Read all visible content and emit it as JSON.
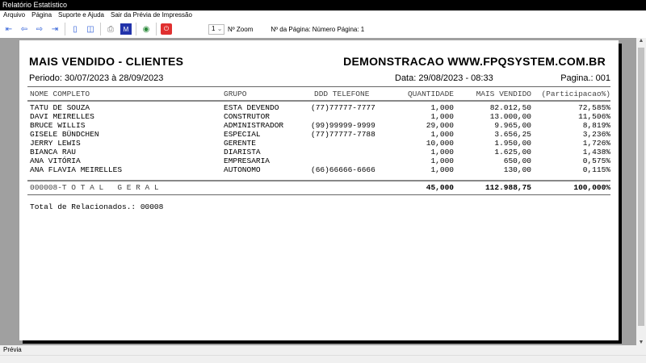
{
  "window": {
    "title": "Relatório Estatístico"
  },
  "menu": [
    "Arquivo",
    "Página",
    "Suporte e Ajuda",
    "Sair da Prévia de Impressão"
  ],
  "toolbar": {
    "page_select": "1",
    "zoom_label": "Nº Zoom",
    "page_info": "Nº da Página: Número Página: 1"
  },
  "report": {
    "title": "MAIS VENDIDO - CLIENTES",
    "company": "DEMONSTRACAO WWW.FPQSYSTEM.COM.BR",
    "period": "Periodo: 30/07/2023 à 28/09/2023",
    "date": "Data: 29/08/2023 - 08:33",
    "page": "Pagina.: 001",
    "columns": [
      "NOME COMPLETO",
      "GRUPO",
      "DDD TELEFONE",
      "QUANTIDADE",
      "MAIS VENDIDO",
      "(Participacao%)"
    ],
    "rows": [
      [
        "TATU DE SOUZA",
        "ESTA DEVENDO",
        "(77)77777-7777",
        "1,000",
        "82.012,50",
        "72,585%"
      ],
      [
        "DAVI MEIRELLES",
        "CONSTRUTOR",
        "",
        "1,000",
        "13.000,00",
        "11,506%"
      ],
      [
        "BRUCE WILLIS",
        "ADMINISTRADOR",
        "(99)99999-9999",
        "29,000",
        "9.965,00",
        "8,819%"
      ],
      [
        "GISELE BÜNDCHEN",
        "ESPECIAL",
        "(77)77777-7788",
        "1,000",
        "3.656,25",
        "3,236%"
      ],
      [
        "JERRY LEWIS",
        "GERENTE",
        "",
        "10,000",
        "1.950,00",
        "1,726%"
      ],
      [
        "BIANCA RAU",
        "DIARISTA",
        "",
        "1,000",
        "1.625,00",
        "1,438%"
      ],
      [
        "ANA VITÓRIA",
        "EMPRESARIA",
        "",
        "1,000",
        "650,00",
        "0,575%"
      ],
      [
        "ANA FLAVIA MEIRELLES",
        "AUTONOMO",
        "(66)66666-6666",
        "1,000",
        "130,00",
        "0,115%"
      ]
    ],
    "total": {
      "label": "000008-T O T A L   G E R A L",
      "quantidade": "45,000",
      "mais_vendido": "112.988,75",
      "participacao": "100,000%"
    },
    "footer": "Total de Relacionados.: 00008"
  },
  "status": "Prévia"
}
